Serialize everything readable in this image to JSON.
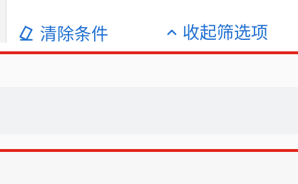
{
  "filter_toolbar": {
    "clear_label": "清除条件",
    "collapse_label": "收起筛选项",
    "clear_icon": "eraser-icon",
    "collapse_icon": "chevron-up-icon"
  },
  "colors": {
    "accent": "#1f6fd1",
    "highlight": "#e1251b"
  }
}
